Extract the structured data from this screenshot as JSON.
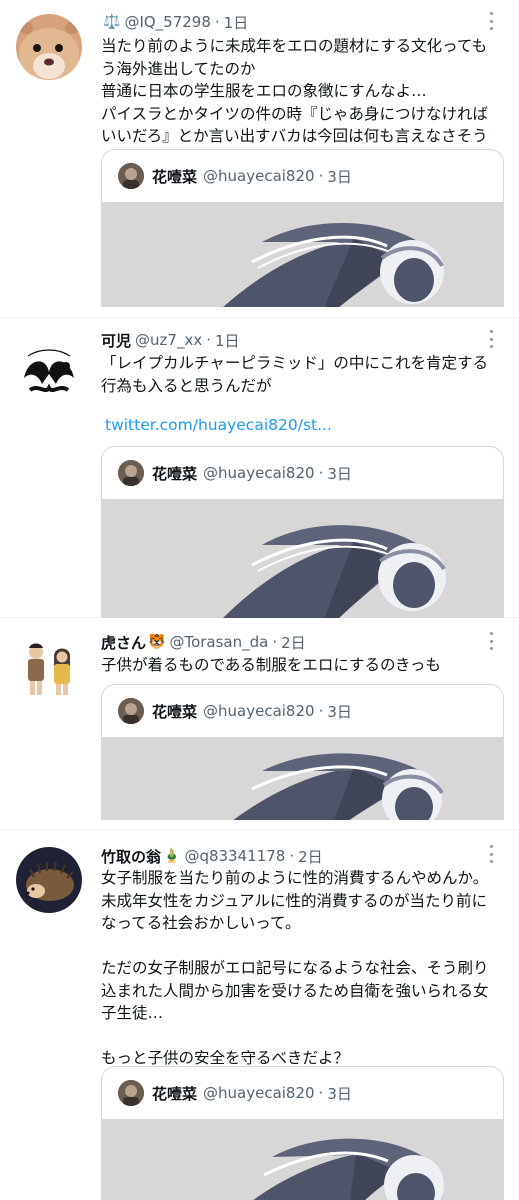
{
  "tweets": [
    {
      "name": "",
      "badge": "⚖️",
      "handle": "@IQ_57298",
      "sep": "·",
      "time": "1日",
      "lines": [
        "当たり前のように未成年をエロの題材にする文化っても",
        "う海外進出してたのか",
        "普通に日本の学生服をエロの象徴にすんなよ…",
        "パイスラとかタイツの件の時『じゃあ身につけなければ",
        "いいだろ』とか言い出すバカは今回は何も言えなさそう"
      ]
    },
    {
      "name": "可児",
      "badge": "",
      "handle": "@uz7_xx",
      "sep": "·",
      "time": "1日",
      "lines": [
        "「レイプカルチャーピラミッド」の中にこれを肯定する",
        "行為も入ると思うんだが"
      ],
      "link": "twitter.com/huayecai820/st..."
    },
    {
      "name": "虎さん",
      "badge": "🐯",
      "handle": "@Torasan_da",
      "sep": "·",
      "time": "2日",
      "lines": [
        "子供が着るものである制服をエロにするのきっも"
      ]
    },
    {
      "name": "竹取の翁",
      "badge": "🎍",
      "handle": "@q83341178",
      "sep": "·",
      "time": "2日",
      "lines": [
        "女子制服を当たり前のように性的消費するんやめんか。",
        "未成年女性をカジュアルに性的消費するのが当たり前に",
        "なってる社会おかしいって。",
        "",
        "ただの女子制服がエロ記号になるような社会、そう刷り",
        "込まれた人間から加害を受けるため自衛を強いられる女",
        "子生徒…",
        "",
        "もっと子供の安全を守るべきだよ？"
      ]
    }
  ],
  "quoted": {
    "name": "花噎菜",
    "handle": "@huayecai820",
    "sep": "·",
    "time": "3日"
  },
  "colors": {
    "link": "#1d9bf0",
    "secondary_text": "#536471",
    "border": "#cfd9de",
    "divider": "#eff3f4"
  },
  "icons": [
    "more-icon"
  ]
}
